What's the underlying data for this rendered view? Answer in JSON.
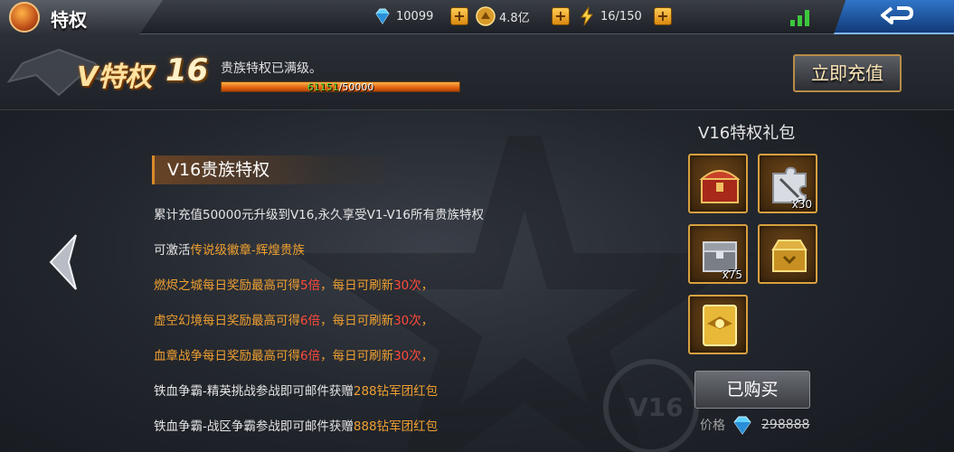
{
  "topbar": {
    "title": "特权",
    "diamonds": "10099",
    "gold": "4.8亿",
    "stamina": "16/150",
    "plus_label": "+"
  },
  "vip": {
    "label": "V特权",
    "level": "16",
    "status": "贵族特权已满级。",
    "progress_current": "61151",
    "progress_sep": "/",
    "progress_total": "50000",
    "progress_fraction": 1.0,
    "recharge_label": "立即充值"
  },
  "privileges": {
    "title": "V16贵族特权",
    "line1": "累计充值50000元升级到V16,永久享受V1-V16所有贵族特权",
    "line2_prefix": "可激活",
    "line2_highlight": "传说级徽章-辉煌贵族",
    "line3": {
      "a": "燃烬之城每日奖励最高可得",
      "b": "5倍",
      "c": "，每日可刷新",
      "d": "30次",
      "e": "，"
    },
    "line4": {
      "a": "虚空幻境每日奖励最高可得",
      "b": "6倍",
      "c": "，每日可刷新",
      "d": "30次",
      "e": "，"
    },
    "line5": {
      "a": "血章战争每日奖励最高可得",
      "b": "6倍",
      "c": "，每日可刷新",
      "d": "30次",
      "e": "，"
    },
    "line6": {
      "a": "铁血争霸-精英挑战参战即可邮件获赠",
      "b": "288钻军团红包"
    },
    "line7": {
      "a": "铁血争霸-战区争霸参战即可邮件获赠",
      "b": "888钻军团红包"
    }
  },
  "gift": {
    "title": "V16特权礼包",
    "items": [
      {
        "icon": "red-treasure-chest-icon",
        "count": ""
      },
      {
        "icon": "puzzle-fragment-icon",
        "count": "x30"
      },
      {
        "icon": "silver-chest-icon",
        "count": "x75"
      },
      {
        "icon": "gold-chest-icon",
        "count": ""
      },
      {
        "icon": "gold-badge-card-icon",
        "count": ""
      }
    ],
    "bought_label": "已购买",
    "price_label": "价格",
    "price_value": "298888"
  },
  "colors": {
    "accent_orange": "#f0a030",
    "highlight_red": "#ff4a3a",
    "progress_green": "#58d838"
  }
}
